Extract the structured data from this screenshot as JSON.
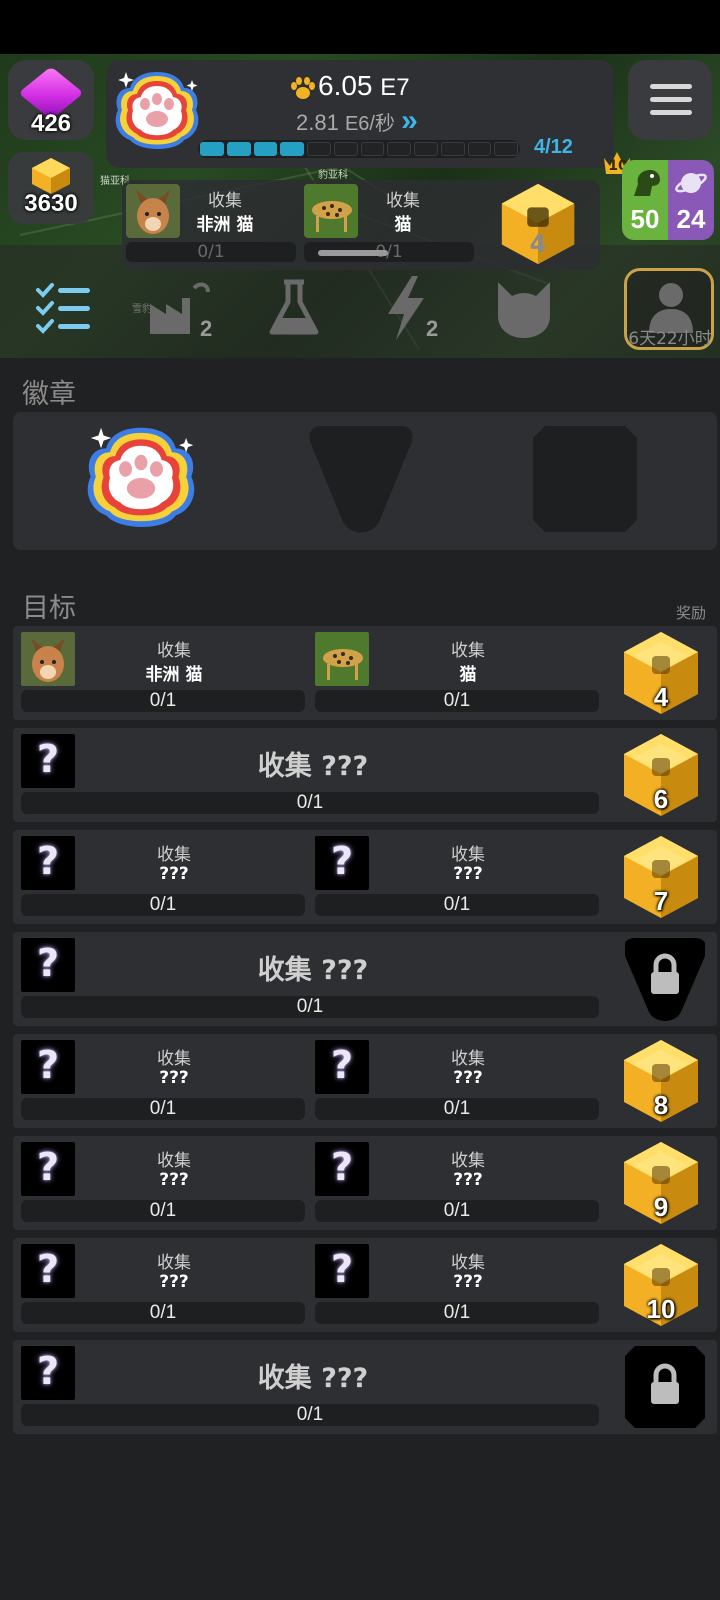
{
  "header": {
    "gems": "426",
    "gold": "3630",
    "paw_amount": "6.05",
    "paw_exp": "E7",
    "rate_value": "2.81",
    "rate_exp": "E6/秒",
    "rate_chevron": "»",
    "progress_text": "4/12",
    "progress_segments_filled": 4,
    "progress_segments_total": 12,
    "collect_strip": [
      {
        "label": "收集",
        "name": "非洲 猫",
        "progress": "0/1"
      },
      {
        "label": "收集",
        "name": "猫",
        "progress": "0/1"
      }
    ],
    "strip_reward": "4",
    "crown_level": "10",
    "counter_green": "50",
    "counter_purple": "24",
    "map_labels": [
      "猫亚科",
      "豹亚科",
      "雪豹"
    ]
  },
  "tabs": {
    "items": [
      {
        "icon": "checklist-icon",
        "badge": ""
      },
      {
        "icon": "factory-icon",
        "badge": "2"
      },
      {
        "icon": "flask-icon",
        "badge": ""
      },
      {
        "icon": "lightning-icon",
        "badge": "2"
      },
      {
        "icon": "cat-icon",
        "badge": ""
      }
    ],
    "timer": "6天22小时"
  },
  "badges": {
    "title": "徽章"
  },
  "goals": {
    "title": "目标",
    "reward_label": "奖励",
    "rows": [
      {
        "type": "double",
        "a_label": "收集",
        "a_name": "非洲 猫",
        "a_progress": "0/1",
        "b_label": "收集",
        "b_name": "猫",
        "b_progress": "0/1",
        "reward": "4"
      },
      {
        "type": "single",
        "text": "收集 ???",
        "progress": "0/1",
        "reward": "6"
      },
      {
        "type": "double",
        "a_label": "收集",
        "a_name": "???",
        "a_progress": "0/1",
        "b_label": "收集",
        "b_name": "???",
        "b_progress": "0/1",
        "reward": "7"
      },
      {
        "type": "single",
        "text": "收集 ???",
        "progress": "0/1",
        "reward": "locked"
      },
      {
        "type": "double",
        "a_label": "收集",
        "a_name": "???",
        "a_progress": "0/1",
        "b_label": "收集",
        "b_name": "???",
        "b_progress": "0/1",
        "reward": "8"
      },
      {
        "type": "double",
        "a_label": "收集",
        "a_name": "???",
        "a_progress": "0/1",
        "b_label": "收集",
        "b_name": "???",
        "b_progress": "0/1",
        "reward": "9"
      },
      {
        "type": "double",
        "a_label": "收集",
        "a_name": "???",
        "a_progress": "0/1",
        "b_label": "收集",
        "b_name": "???",
        "b_progress": "0/1",
        "reward": "10"
      },
      {
        "type": "single",
        "text": "收集 ???",
        "progress": "0/1",
        "reward": "locked-box"
      }
    ]
  },
  "question_mark": "?",
  "colors": {
    "accent": "#3fb5e6",
    "bg": "#202123",
    "panel": "#2e2f32",
    "gold": "#f0b323",
    "green": "#6ab33e",
    "purple": "#8a59b8"
  }
}
